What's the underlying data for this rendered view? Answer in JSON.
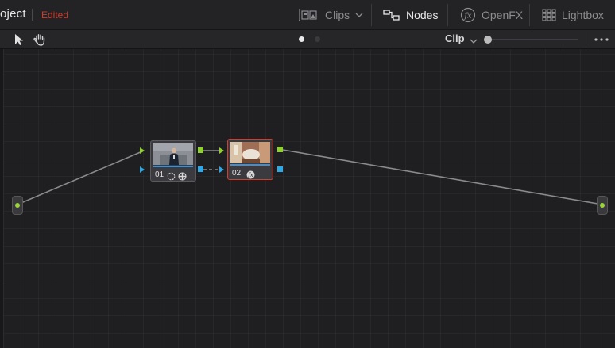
{
  "header": {
    "project_title": "oject",
    "project_status": "Edited",
    "status_color": "#d23a2c",
    "buttons": {
      "clips": {
        "label": "Clips",
        "icon": "media-clips-icon"
      },
      "nodes": {
        "label": "Nodes",
        "icon": "nodes-icon",
        "active": true
      },
      "openfx": {
        "label": "OpenFX",
        "icon": "fx-icon"
      },
      "lightbox": {
        "label": "Lightbox",
        "icon": "grid-icon"
      }
    }
  },
  "toolbar": {
    "tools": [
      "pointer-tool-icon",
      "hand-tool-icon"
    ],
    "pages": 2,
    "active_page": 1,
    "mode_label": "Clip",
    "zoom": 0,
    "more_icon": "more-options-icon"
  },
  "node_graph": {
    "nodes": [
      {
        "number": "01",
        "selected": false,
        "icons": [
          "selection-icon",
          "qualifier-icon"
        ]
      },
      {
        "number": "02",
        "selected": true,
        "icons": [
          "fx-badge-icon"
        ]
      }
    ],
    "accent_colors": {
      "rgb_link": "#8fd12f",
      "key_link": "#2fa8e6",
      "selected_border": "#d13d2f"
    }
  }
}
